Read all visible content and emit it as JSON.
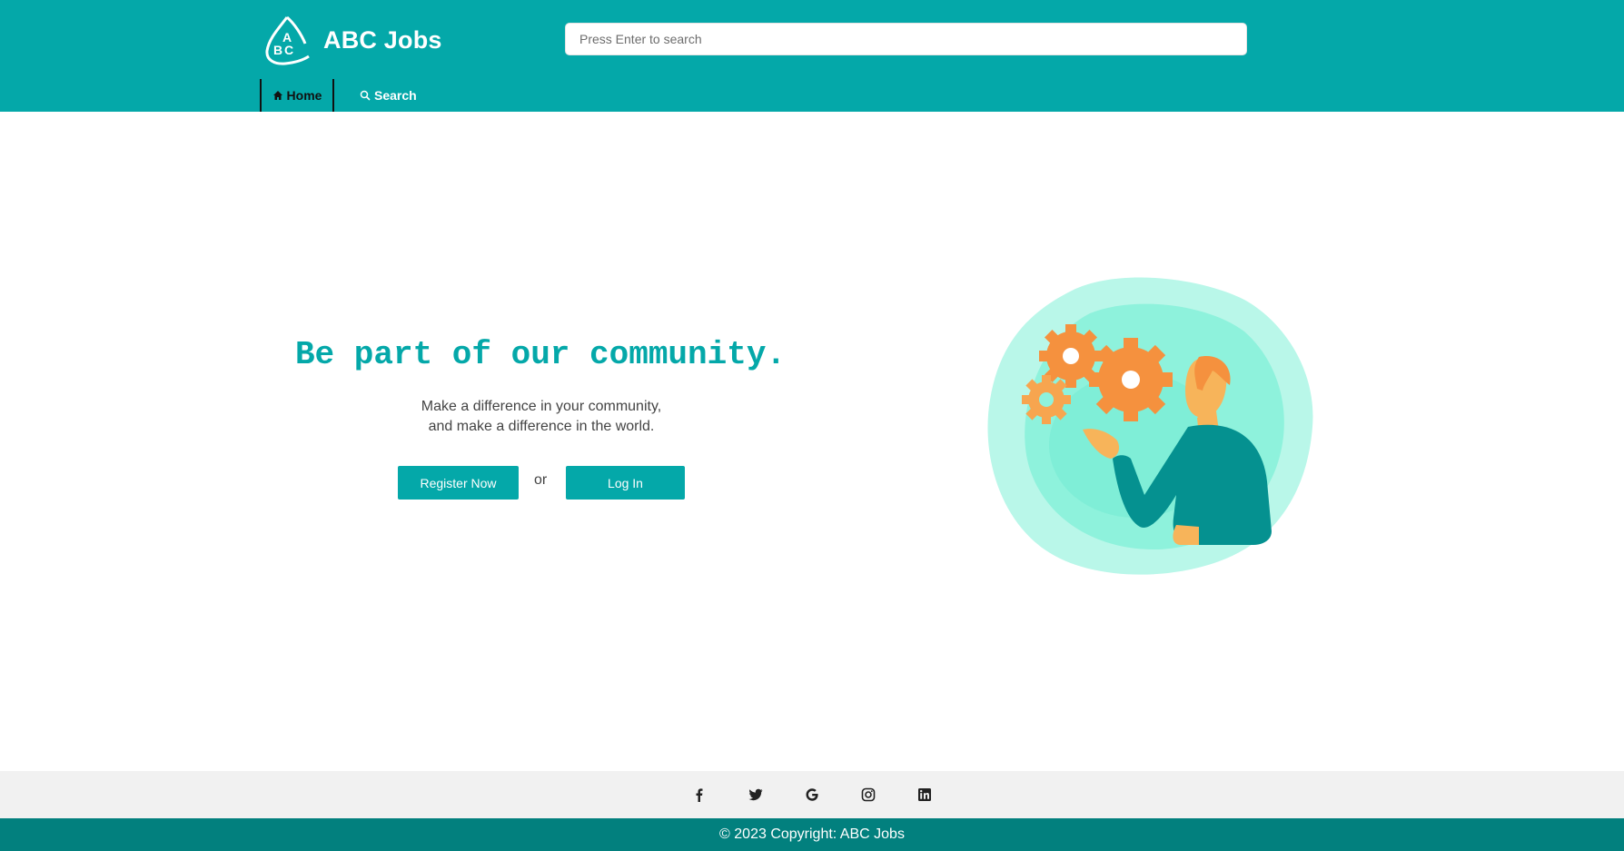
{
  "brand": {
    "name": "ABC Jobs",
    "logo_letters": "ABC"
  },
  "search": {
    "placeholder": "Press Enter to search"
  },
  "nav": {
    "items": [
      {
        "label": "Home",
        "icon": "home-icon"
      },
      {
        "label": "Search",
        "icon": "search-icon"
      }
    ]
  },
  "hero": {
    "title": "Be part of our community.",
    "subtitle_line1": "Make a difference in your community,",
    "subtitle_line2": "and make a difference in the world.",
    "register_label": "Register Now",
    "or_label": "or",
    "login_label": "Log In"
  },
  "social": {
    "icons": [
      "facebook-icon",
      "twitter-icon",
      "google-icon",
      "instagram-icon",
      "linkedin-icon"
    ]
  },
  "footer": {
    "copyright": "© 2023 Copyright: ABC Jobs"
  },
  "colors": {
    "primary": "#04a8a9",
    "footer_bg": "#02807e",
    "social_bg": "#f1f1f1",
    "gear": "#f5913e",
    "skin": "#f7b45a",
    "blob": "#7ff0d8",
    "shirt": "#059190"
  }
}
